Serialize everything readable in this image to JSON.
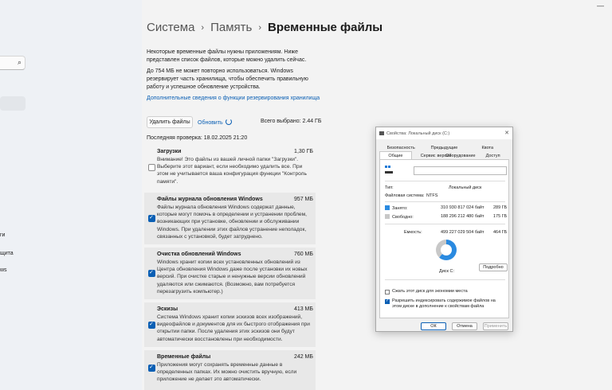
{
  "window": {
    "minimize_glyph": "—"
  },
  "sidebar": {
    "search_icon": "search-icon",
    "fragments": [
      "ги",
      "щита",
      "ws"
    ]
  },
  "breadcrumb": {
    "items": [
      "Система",
      "Память",
      "Временные файлы"
    ],
    "separator": "›"
  },
  "intro": {
    "p1": "Некоторые временные файлы нужны приложениям. Ниже представлен список файлов, которые можно удалить сейчас.",
    "p2": "До 754 МБ не может повторно использоваться. Windows резервирует часть хранилища, чтобы обеспечить правильную работу и успешное обновление устройства.",
    "link": "Дополнительные сведения о функции резервирования хранилища"
  },
  "actions": {
    "delete_label": "Удалить файлы",
    "refresh_label": "Обновить",
    "total_selected": "Всего выбрано: 2.44 ГБ",
    "last_check": "Последняя проверка: 18.02.2025 21:20"
  },
  "items": [
    {
      "name": "Загрузки",
      "size": "1,30 ГБ",
      "checked": false,
      "desc": "Внимание! Это файлы из вашей личной папки \"Загрузки\". Выберите этот вариант, если необходимо удалить все. При этом не учитывается ваша конфигурация функции \"Контроль памяти\"."
    },
    {
      "name": "Файлы журнала обновления Windows",
      "size": "957 МБ",
      "checked": true,
      "desc": "Файлы журнала обновления Windows содержат данные, которые могут помочь в определении и устранении проблем, возникающих при установке, обновлении и обслуживании Windows. При удалении этих файлов устранение неполадок, связанных с установкой, будет затруднено."
    },
    {
      "name": "Очистка обновлений Windows",
      "size": "760 МБ",
      "checked": true,
      "desc": "Windows хранит копии всех установленных обновлений из Центра обновления Windows даже после установки их новых версий. При очистке старые и ненужные версии обновлений удаляются или сжимаются. (Возможно, вам потребуется перезагрузить компьютер.)"
    },
    {
      "name": "Эскизы",
      "size": "413 МБ",
      "checked": true,
      "desc": "Система Windows хранит копии эскизов всех изображений, видеофайлов и документов для их быстрого отображения при открытии папки. После удаления этих эскизов они будут автоматически восстановлены при необходимости."
    },
    {
      "name": "Временные файлы",
      "size": "242 МБ",
      "checked": true,
      "desc": "Приложения могут сохранять временные данные в определенных папках. Их можно очистить вручную, если приложение не делает это автоматически."
    }
  ],
  "dialog": {
    "title": "Свойства: Локальный диск (C:)",
    "close_glyph": "✕",
    "tabs_row1": [
      "Безопасность",
      "Предыдущие версии",
      "Квота"
    ],
    "tabs_row2": [
      "Общие",
      "Сервис",
      "Оборудование",
      "Доступ"
    ],
    "type_label": "Тип:",
    "type_value": "Локальный диск",
    "fs_label": "Файловая система:",
    "fs_value": "NTFS",
    "used_label": "Занято:",
    "used_bytes": "310 930 817 024 байт",
    "used_gb": "289 ГБ",
    "free_label": "Свободно:",
    "free_bytes": "188 296 212 480 байт",
    "free_gb": "175 ГБ",
    "cap_label": "Емкость:",
    "cap_bytes": "499 227 029 504 байт",
    "cap_gb": "464 ГБ",
    "used_fraction": 0.62,
    "disk_label": "Диск C:",
    "details_btn": "Подробно",
    "compress_label": "Сжать этот диск для экономии места",
    "compress_checked": false,
    "index_label": "Разрешить индексировать содержимое файлов на этом диске в дополнение к свойствам файла",
    "index_checked": true,
    "ok": "ОК",
    "cancel": "Отмена",
    "apply": "Применить",
    "colors": {
      "used": "#2a8ae0",
      "free": "#c8c8c8"
    }
  }
}
